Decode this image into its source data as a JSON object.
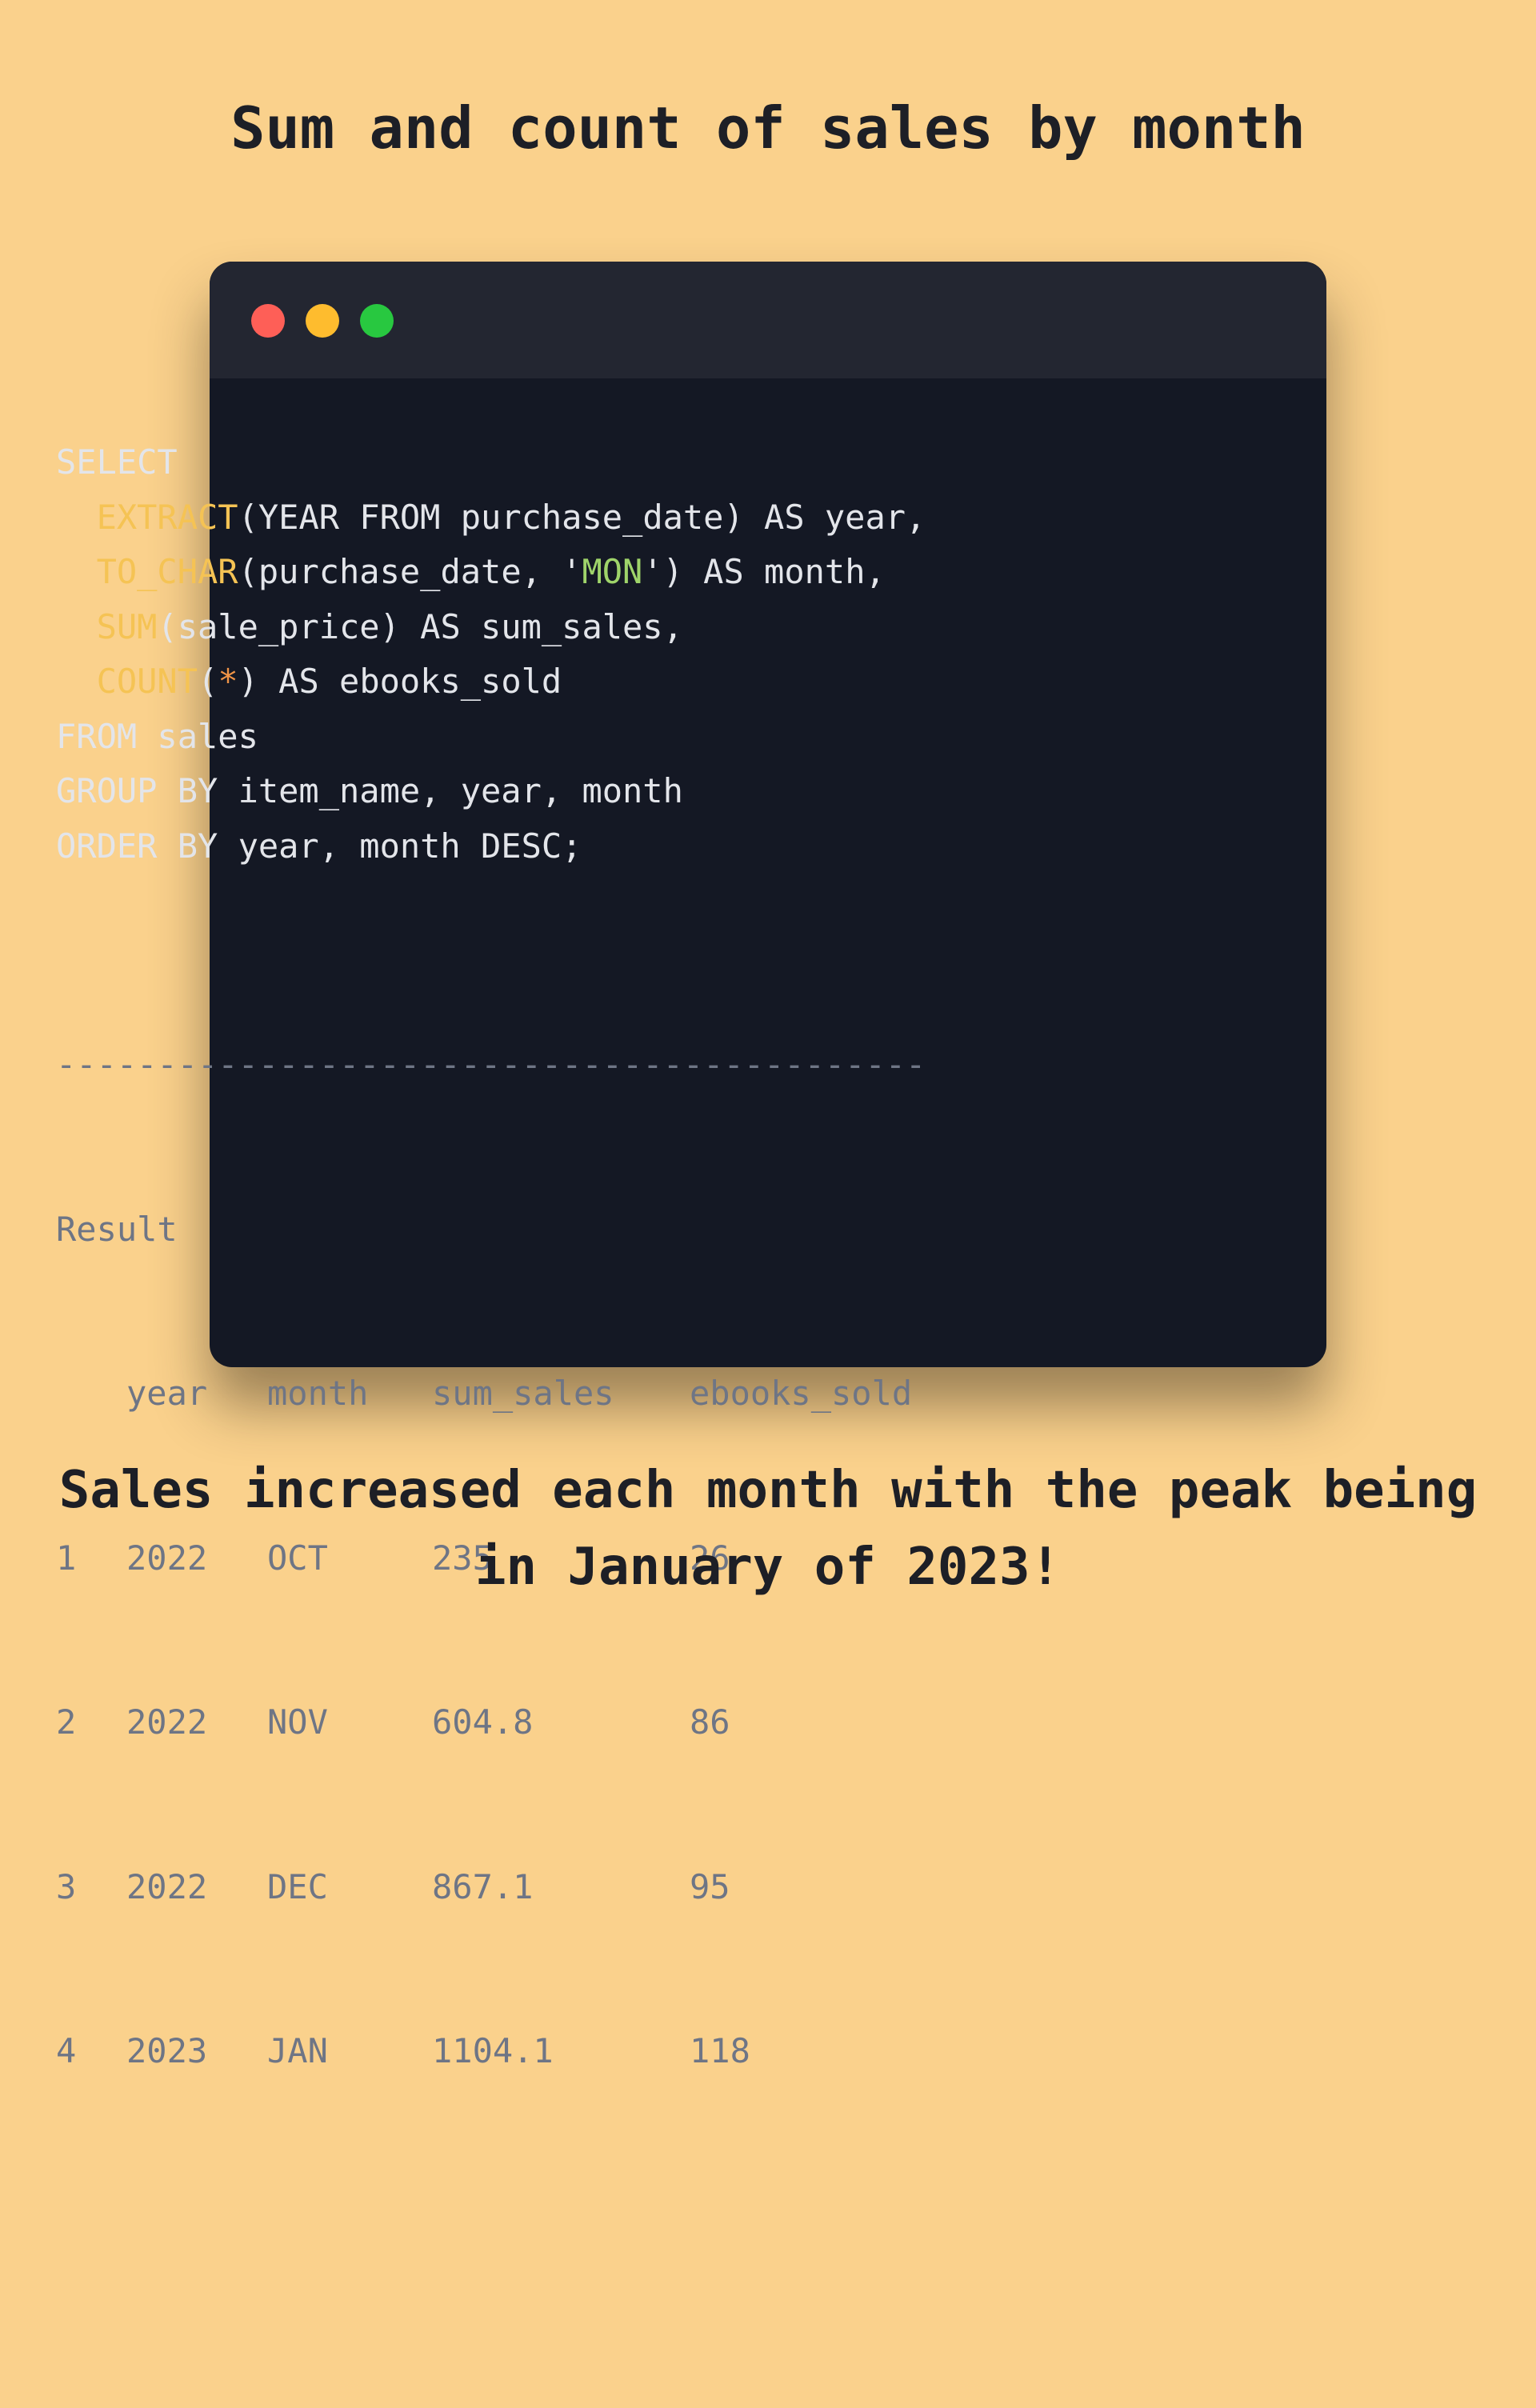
{
  "title": "Sum and count of sales by month",
  "window": {
    "dots": [
      {
        "name": "close",
        "color": "#fe5f57"
      },
      {
        "name": "minimize",
        "color": "#febc2e"
      },
      {
        "name": "maximize",
        "color": "#28c840"
      }
    ]
  },
  "code": {
    "lines": [
      [
        {
          "t": "SELECT",
          "c": "plain"
        }
      ],
      [
        {
          "t": "  ",
          "c": "plain"
        },
        {
          "t": "EXTRACT",
          "c": "fn"
        },
        {
          "t": "(YEAR FROM purchase_date) AS year,",
          "c": "plain"
        }
      ],
      [
        {
          "t": "  ",
          "c": "plain"
        },
        {
          "t": "TO_CHAR",
          "c": "fn"
        },
        {
          "t": "(purchase_date, '",
          "c": "plain"
        },
        {
          "t": "MON",
          "c": "str"
        },
        {
          "t": "') AS month,",
          "c": "plain"
        }
      ],
      [
        {
          "t": "  ",
          "c": "plain"
        },
        {
          "t": "SUM",
          "c": "fn"
        },
        {
          "t": "(sale_price) AS sum_sales,",
          "c": "plain"
        }
      ],
      [
        {
          "t": "  ",
          "c": "plain"
        },
        {
          "t": "COUNT",
          "c": "fn"
        },
        {
          "t": "(",
          "c": "plain"
        },
        {
          "t": "*",
          "c": "star"
        },
        {
          "t": ") AS ebooks_sold",
          "c": "plain"
        }
      ],
      [
        {
          "t": "FROM sales",
          "c": "plain"
        }
      ],
      [
        {
          "t": "GROUP BY item_name, year, month",
          "c": "plain"
        }
      ],
      [
        {
          "t": "ORDER BY year, month DESC;",
          "c": "plain"
        }
      ]
    ]
  },
  "result": {
    "separator": "-------------------------------------------",
    "label": "Result",
    "columns": [
      "year",
      "month",
      "sum_sales",
      "ebooks_sold"
    ],
    "rows": [
      [
        "1",
        "2022",
        "OCT",
        "235",
        "26"
      ],
      [
        "2",
        "2022",
        "NOV",
        "604.8",
        "86"
      ],
      [
        "3",
        "2022",
        "DEC",
        "867.1",
        "95"
      ],
      [
        "4",
        "2023",
        "JAN",
        "1104.1",
        "118"
      ]
    ]
  },
  "footer": {
    "line1": "Sales increased each month with the peak being",
    "line2": "in January of 2023!"
  }
}
